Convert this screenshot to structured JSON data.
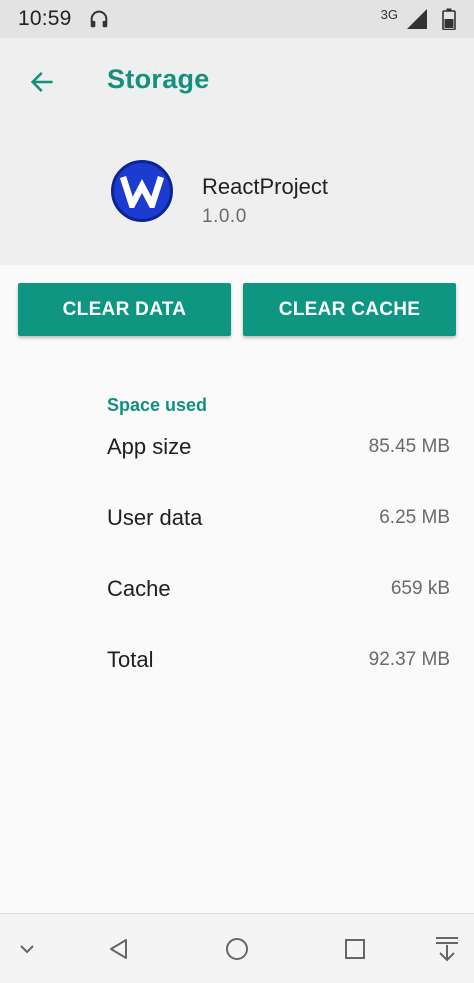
{
  "status_bar": {
    "time": "10:59",
    "network_type": "3G",
    "icons": [
      "headphones-icon",
      "signal-icon",
      "battery-icon"
    ]
  },
  "header": {
    "title": "Storage",
    "back_icon": "arrow-left-icon"
  },
  "app": {
    "name": "ReactProject",
    "version": "1.0.0",
    "icon": "app-logo-w",
    "icon_letter": "W"
  },
  "actions": {
    "clear_data": "CLEAR DATA",
    "clear_cache": "CLEAR CACHE"
  },
  "space_used": {
    "title": "Space used",
    "rows": [
      {
        "label": "App size",
        "value": "85.45 MB"
      },
      {
        "label": "User data",
        "value": "6.25 MB"
      },
      {
        "label": "Cache",
        "value": "659 kB"
      },
      {
        "label": "Total",
        "value": "92.37 MB"
      }
    ]
  },
  "nav_bar": {
    "icons": [
      "chevron-down-icon",
      "back-triangle-icon",
      "home-circle-icon",
      "recents-square-icon",
      "download-icon"
    ]
  },
  "colors": {
    "accent": "#12917f",
    "button": "#0e9683",
    "app_icon": "#1b3bd1"
  }
}
